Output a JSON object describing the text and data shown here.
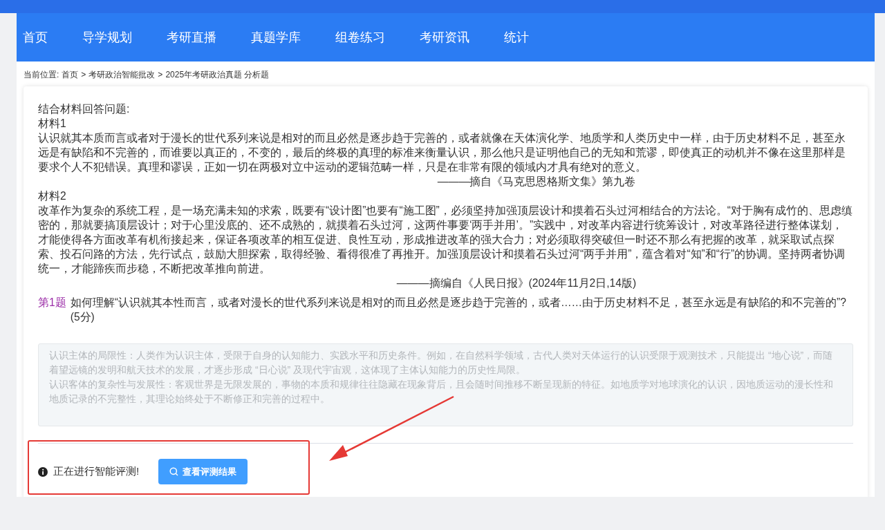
{
  "nav": [
    {
      "label": "首页",
      "selected": false
    },
    {
      "label": "导学规划",
      "selected": false
    },
    {
      "label": "考研直播",
      "selected": false
    },
    {
      "label": "真题学库",
      "selected": false
    },
    {
      "label": "组卷练习",
      "selected": false
    },
    {
      "label": "考研资讯",
      "selected": false
    },
    {
      "label": "统计",
      "selected": false
    }
  ],
  "breadcrumb": {
    "label": "当前位置:",
    "separator": ">",
    "items": [
      "首页",
      "考研政治智能批改",
      "2025年考研政治真题 分析题"
    ]
  },
  "intro": "结合材料回答问题:",
  "materials": [
    {
      "title": "材料1",
      "text": "认识就其本质而言或者对于漫长的世代系列来说是相对的而且必然是逐步趋于完善的，或者就像在天体演化学、地质学和人类历史中一样，由于历史材料不足，甚至永远是有缺陷和不完善的，而谁要以真正的，不变的，最后的终极的真理的标准来衡量认识，那么他只是证明他自己的无知和荒谬，即使真正的动机并不像在这里那样是要求个人不犯错误。真理和谬误，正如一切在两极对立中运动的逻辑范畴一样，只是在非常有限的领域内才具有绝对的意义。",
      "source": "———摘自《马克思恩格斯文集》第九卷"
    },
    {
      "title": "材料2",
      "text": "改革作为复杂的系统工程，是一场充满未知的求索，既要有“设计图”也要有“施工图”，必须坚持加强顶层设计和摸着石头过河相结合的方法论。“对于胸有成竹的、思虑缜密的，那就要搞顶层设计；对于心里没底的、还不成熟的，就摸着石头过河，这两件事要‘两手并用’。”实践中，对改革内容进行统筹设计，对改革路径进行整体谋划，才能使得各方面改革有机衔接起来，保证各项改革的相互促进、良性互动，形成推进改革的强大合力；对必须取得突破但一时还不那么有把握的改革，就采取试点探索、投石问路的方法，先行试点，鼓励大胆探索，取得经验、看得很准了再推开。加强顶层设计和摸着石头过河“两手并用”，蕴含着对“知”和“行”的协调。坚持两者协调统一，才能蹄疾而步稳，不断把改革推向前进。",
      "source": "———摘编自《人民日报》(2024年11月2日,14版)"
    }
  ],
  "question": {
    "number": "第1题",
    "text": "如何理解“认识就其本性而言，或者对漫长的世代系列来说是相对的而且必然是逐步趋于完善的，或者……由于历史材料不足，甚至永远是有缺陷的和不完善的”?(5分)"
  },
  "answer": {
    "lines": [
      "认识主体的局限性：人类作为认识主体，受限于自身的认知能力、实践水平和历史条件。例如，在自然科学领域，古代人类对天体运行的认识受限于观测技术，只能提出 “地心说”，而随着望远镜的发明和航天技术的发展，才逐步形成 “日心说” 及现代宇宙观，这体现了主体认知能力的历史性局限。",
      "认识客体的复杂性与发展性：客观世界是无限发展的，事物的本质和规律往往隐藏在现象背后，且会随时间推移不断呈现新的特征。如地质学对地球演化的认识，因地质运动的漫长性和地质记录的不完整性，其理论始终处于不断修正和完善的过程中。"
    ],
    "disabled": true
  },
  "status": {
    "message": "正在进行智能评测!",
    "button": "查看评测结果"
  }
}
